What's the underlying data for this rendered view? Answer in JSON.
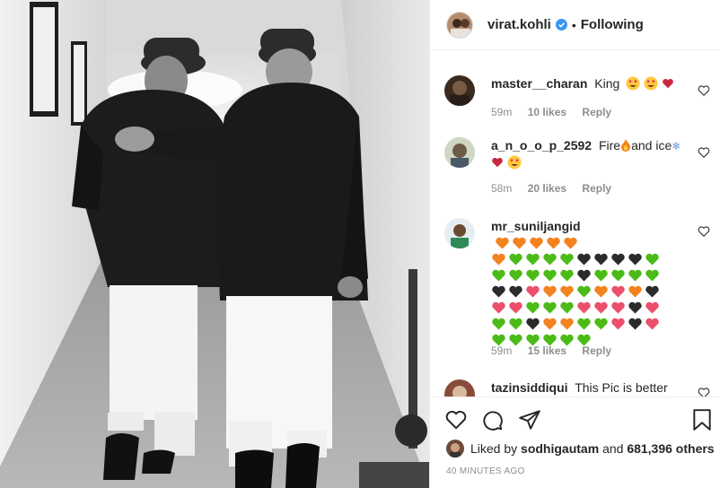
{
  "post": {
    "username": "virat.kohli",
    "dot": "•",
    "follow_status": "Following",
    "likes_user": "sodhigautam",
    "likes_others": "681,396 others",
    "liked_by_prefix": "Liked by",
    "and_text": "and",
    "time_ago": "40 MINUTES AGO"
  },
  "comments": [
    {
      "username": "master__charan",
      "text": "King",
      "time": "59m",
      "likes": "10 likes",
      "reply": "Reply"
    },
    {
      "username": "a_n_o_o_p_2592",
      "text": "Fire",
      "text2": "and ice",
      "time": "58m",
      "likes": "20 likes",
      "reply": "Reply"
    },
    {
      "username": "mr_suniljangid",
      "text": "",
      "time": "59m",
      "likes": "15 likes",
      "reply": "Reply"
    },
    {
      "username": "tazinsiddiqui",
      "text": "This Pic is better"
    }
  ],
  "colors": {
    "orange": "#f4821f",
    "green": "#4cbb17",
    "black": "#2b2b2b",
    "pink": "#ec4f6b",
    "verified": "#3897f0"
  }
}
